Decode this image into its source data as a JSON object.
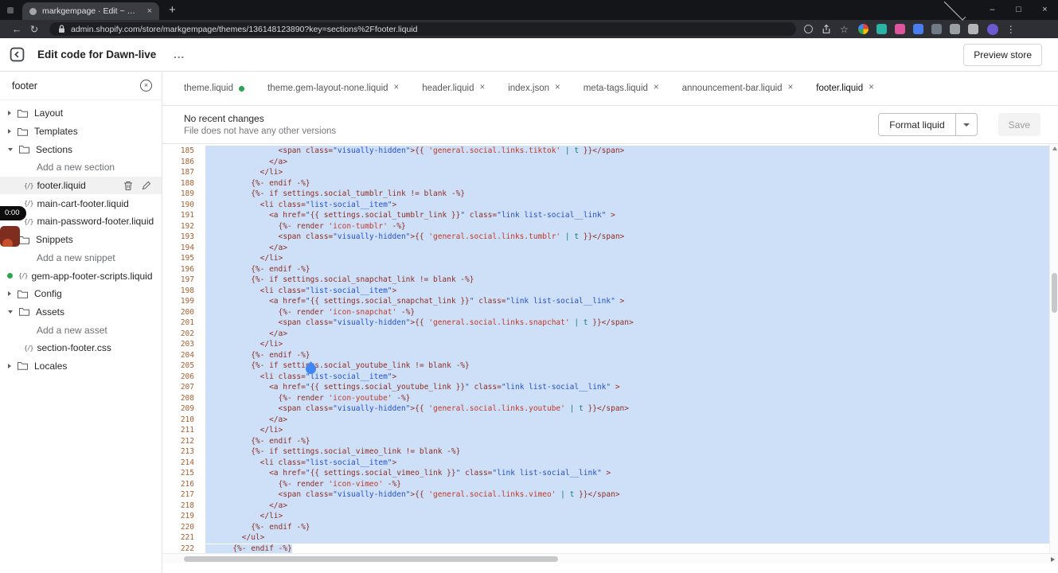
{
  "browser": {
    "tab": {
      "title": "markgempage · Edit ~ Dawn-live"
    },
    "url": "admin.shopify.com/store/markgempage/themes/136148123890?key=sections%2Ffooter.liquid"
  },
  "icons": {
    "close": "×",
    "plus": "+",
    "back": "←",
    "refresh": "↻",
    "star": "☆",
    "kebab": "⋮",
    "minimize": "–",
    "maximize": "□",
    "menu_dots": "...",
    "clear": "×",
    "file_glyph": "{/}"
  },
  "extensions": [
    {
      "name": "apps-grid-icon",
      "color": "conic"
    },
    {
      "name": "extension-icon-teal",
      "color": "#2ab3a6"
    },
    {
      "name": "extension-icon-pink",
      "color": "#e0549d"
    },
    {
      "name": "extension-icon-blue",
      "color": "#4a7df0"
    },
    {
      "name": "extension-icon-slate",
      "color": "#6f7a86"
    },
    {
      "name": "extension-icon-monitor",
      "color": "#9aa0a6"
    },
    {
      "name": "extension-icon-lines",
      "color": "#b3b6b9"
    }
  ],
  "avatar_color": "#6b5bd2",
  "app_header": {
    "title": "Edit code for Dawn-live",
    "menu": "...",
    "preview_button": "Preview store"
  },
  "recording": {
    "timer": "0:00"
  },
  "sidebar": {
    "search": {
      "value": "footer"
    },
    "tree": [
      {
        "type": "group",
        "label": "Layout",
        "expanded": false
      },
      {
        "type": "group",
        "label": "Templates",
        "expanded": false
      },
      {
        "type": "group",
        "label": "Sections",
        "expanded": true
      },
      {
        "type": "action",
        "label": "Add a new section"
      },
      {
        "type": "file",
        "label": "footer.liquid",
        "selected": true,
        "actions": true
      },
      {
        "type": "file",
        "label": "main-cart-footer.liquid"
      },
      {
        "type": "file",
        "label": "main-password-footer.liquid"
      },
      {
        "type": "group",
        "label": "Snippets",
        "expanded": true
      },
      {
        "type": "action",
        "label": "Add a new snippet"
      },
      {
        "type": "file",
        "label": "gem-app-footer-scripts.liquid",
        "dot": true
      },
      {
        "type": "group",
        "label": "Config",
        "expanded": false
      },
      {
        "type": "group",
        "label": "Assets",
        "expanded": true
      },
      {
        "type": "action",
        "label": "Add a new asset"
      },
      {
        "type": "file",
        "label": "section-footer.css"
      },
      {
        "type": "group",
        "label": "Locales",
        "expanded": false
      }
    ]
  },
  "tabs": [
    {
      "label": "theme.liquid",
      "dot": true,
      "close": false,
      "active": false
    },
    {
      "label": "theme.gem-layout-none.liquid",
      "dot": false,
      "close": true,
      "active": false
    },
    {
      "label": "header.liquid",
      "dot": false,
      "close": true,
      "active": false
    },
    {
      "label": "index.json",
      "dot": false,
      "close": true,
      "active": false
    },
    {
      "label": "meta-tags.liquid",
      "dot": false,
      "close": true,
      "active": false
    },
    {
      "label": "announcement-bar.liquid",
      "dot": false,
      "close": true,
      "active": false
    },
    {
      "label": "footer.liquid",
      "dot": false,
      "close": true,
      "active": true
    }
  ],
  "status": {
    "title": "No recent changes",
    "subtitle": "File does not have any other versions",
    "format_button": "Format liquid",
    "save_button": "Save"
  },
  "editor": {
    "first_line": 185,
    "selection_color": "#cde0f7",
    "lines": [
      {
        "n": 185,
        "sel": "full",
        "segs": [
          [
            "m",
            "                <span class="
          ],
          [
            "b",
            "\"visually-hidden\""
          ],
          [
            "m",
            ">{{ "
          ],
          [
            "r",
            "'general.social.links.tiktok'"
          ],
          [
            "m",
            " "
          ],
          [
            "t",
            "| t"
          ],
          [
            "m",
            " }}</span>"
          ]
        ]
      },
      {
        "n": 186,
        "sel": "full",
        "segs": [
          [
            "m",
            "              </a>"
          ]
        ]
      },
      {
        "n": 187,
        "sel": "full",
        "segs": [
          [
            "m",
            "            </li>"
          ]
        ]
      },
      {
        "n": 188,
        "sel": "full",
        "segs": [
          [
            "m",
            "          {%- endif -%}"
          ]
        ]
      },
      {
        "n": 189,
        "sel": "full",
        "segs": [
          [
            "m",
            "          {%- if settings.social_tumblr_link != blank -%}"
          ]
        ]
      },
      {
        "n": 190,
        "sel": "full",
        "segs": [
          [
            "m",
            "            <li class="
          ],
          [
            "b",
            "\"list-social__item\""
          ],
          [
            "m",
            ">"
          ]
        ]
      },
      {
        "n": 191,
        "sel": "full",
        "segs": [
          [
            "m",
            "              <a href="
          ],
          [
            "b",
            "\""
          ],
          [
            "m",
            "{{ settings.social_tumblr_link }}"
          ],
          [
            "b",
            "\""
          ],
          [
            "m",
            " class="
          ],
          [
            "b",
            "\"link list-social__link\""
          ],
          [
            "m",
            " >"
          ]
        ]
      },
      {
        "n": 192,
        "sel": "full",
        "segs": [
          [
            "m",
            "                {%- render "
          ],
          [
            "r",
            "'icon-tumblr'"
          ],
          [
            "m",
            " -%}"
          ]
        ]
      },
      {
        "n": 193,
        "sel": "full",
        "segs": [
          [
            "m",
            "                <span class="
          ],
          [
            "b",
            "\"visually-hidden\""
          ],
          [
            "m",
            ">{{ "
          ],
          [
            "r",
            "'general.social.links.tumblr'"
          ],
          [
            "m",
            " "
          ],
          [
            "t",
            "| t"
          ],
          [
            "m",
            " }}</span>"
          ]
        ]
      },
      {
        "n": 194,
        "sel": "full",
        "segs": [
          [
            "m",
            "              </a>"
          ]
        ]
      },
      {
        "n": 195,
        "sel": "full",
        "segs": [
          [
            "m",
            "            </li>"
          ]
        ]
      },
      {
        "n": 196,
        "sel": "full",
        "segs": [
          [
            "m",
            "          {%- endif -%}"
          ]
        ]
      },
      {
        "n": 197,
        "sel": "full",
        "segs": [
          [
            "m",
            "          {%- if settings.social_snapchat_link != blank -%}"
          ]
        ]
      },
      {
        "n": 198,
        "sel": "full",
        "segs": [
          [
            "m",
            "            <li class="
          ],
          [
            "b",
            "\"list-social__item\""
          ],
          [
            "m",
            ">"
          ]
        ]
      },
      {
        "n": 199,
        "sel": "full",
        "segs": [
          [
            "m",
            "              <a href="
          ],
          [
            "b",
            "\""
          ],
          [
            "m",
            "{{ settings.social_snapchat_link }}"
          ],
          [
            "b",
            "\""
          ],
          [
            "m",
            " class="
          ],
          [
            "b",
            "\"link list-social__link\""
          ],
          [
            "m",
            " >"
          ]
        ]
      },
      {
        "n": 200,
        "sel": "full",
        "segs": [
          [
            "m",
            "                {%- render "
          ],
          [
            "r",
            "'icon-snapchat'"
          ],
          [
            "m",
            " -%}"
          ]
        ]
      },
      {
        "n": 201,
        "sel": "full",
        "segs": [
          [
            "m",
            "                <span class="
          ],
          [
            "b",
            "\"visually-hidden\""
          ],
          [
            "m",
            ">{{ "
          ],
          [
            "r",
            "'general.social.links.snapchat'"
          ],
          [
            "m",
            " "
          ],
          [
            "t",
            "| t"
          ],
          [
            "m",
            " }}</span>"
          ]
        ]
      },
      {
        "n": 202,
        "sel": "full",
        "segs": [
          [
            "m",
            "              </a>"
          ]
        ]
      },
      {
        "n": 203,
        "sel": "full",
        "segs": [
          [
            "m",
            "            </li>"
          ]
        ]
      },
      {
        "n": 204,
        "sel": "full",
        "segs": [
          [
            "m",
            "          {%- endif -%}"
          ]
        ]
      },
      {
        "n": 205,
        "sel": "full",
        "segs": [
          [
            "m",
            "          {%- if settings.social_youtube_link != blank -%}"
          ]
        ]
      },
      {
        "n": 206,
        "sel": "full",
        "segs": [
          [
            "m",
            "            <li class="
          ],
          [
            "b",
            "\"list-social__item\""
          ],
          [
            "m",
            ">"
          ]
        ]
      },
      {
        "n": 207,
        "sel": "full",
        "segs": [
          [
            "m",
            "              <a href="
          ],
          [
            "b",
            "\""
          ],
          [
            "m",
            "{{ settings.social_youtube_link }}"
          ],
          [
            "b",
            "\""
          ],
          [
            "m",
            " class="
          ],
          [
            "b",
            "\"link list-social__link\""
          ],
          [
            "m",
            " >"
          ]
        ]
      },
      {
        "n": 208,
        "sel": "full",
        "segs": [
          [
            "m",
            "                {%- render "
          ],
          [
            "r",
            "'icon-youtube'"
          ],
          [
            "m",
            " -%}"
          ]
        ]
      },
      {
        "n": 209,
        "sel": "full",
        "segs": [
          [
            "m",
            "                <span class="
          ],
          [
            "b",
            "\"visually-hidden\""
          ],
          [
            "m",
            ">{{ "
          ],
          [
            "r",
            "'general.social.links.youtube'"
          ],
          [
            "m",
            " "
          ],
          [
            "t",
            "| t"
          ],
          [
            "m",
            " }}</span>"
          ]
        ]
      },
      {
        "n": 210,
        "sel": "full",
        "segs": [
          [
            "m",
            "              </a>"
          ]
        ]
      },
      {
        "n": 211,
        "sel": "full",
        "segs": [
          [
            "m",
            "            </li>"
          ]
        ]
      },
      {
        "n": 212,
        "sel": "full",
        "segs": [
          [
            "m",
            "          {%- endif -%}"
          ]
        ]
      },
      {
        "n": 213,
        "sel": "full",
        "segs": [
          [
            "m",
            "          {%- if settings.social_vimeo_link != blank -%}"
          ]
        ]
      },
      {
        "n": 214,
        "sel": "full",
        "segs": [
          [
            "m",
            "            <li class="
          ],
          [
            "b",
            "\"list-social__item\""
          ],
          [
            "m",
            ">"
          ]
        ]
      },
      {
        "n": 215,
        "sel": "full",
        "segs": [
          [
            "m",
            "              <a href="
          ],
          [
            "b",
            "\""
          ],
          [
            "m",
            "{{ settings.social_vimeo_link }}"
          ],
          [
            "b",
            "\""
          ],
          [
            "m",
            " class="
          ],
          [
            "b",
            "\"link list-social__link\""
          ],
          [
            "m",
            " >"
          ]
        ]
      },
      {
        "n": 216,
        "sel": "full",
        "segs": [
          [
            "m",
            "                {%- render "
          ],
          [
            "r",
            "'icon-vimeo'"
          ],
          [
            "m",
            " -%}"
          ]
        ]
      },
      {
        "n": 217,
        "sel": "full",
        "segs": [
          [
            "m",
            "                <span class="
          ],
          [
            "b",
            "\"visually-hidden\""
          ],
          [
            "m",
            ">{{ "
          ],
          [
            "r",
            "'general.social.links.vimeo'"
          ],
          [
            "m",
            " "
          ],
          [
            "t",
            "| t"
          ],
          [
            "m",
            " }}</span>"
          ]
        ]
      },
      {
        "n": 218,
        "sel": "full",
        "segs": [
          [
            "m",
            "              </a>"
          ]
        ]
      },
      {
        "n": 219,
        "sel": "full",
        "segs": [
          [
            "m",
            "            </li>"
          ]
        ]
      },
      {
        "n": 220,
        "sel": "full",
        "segs": [
          [
            "m",
            "          {%- endif -%}"
          ]
        ]
      },
      {
        "n": 221,
        "sel": "full",
        "segs": [
          [
            "m",
            "        </ul>"
          ]
        ]
      },
      {
        "n": 222,
        "sel": "text",
        "segs": [
          [
            "m",
            "      {%- endif -%}"
          ]
        ]
      }
    ]
  }
}
